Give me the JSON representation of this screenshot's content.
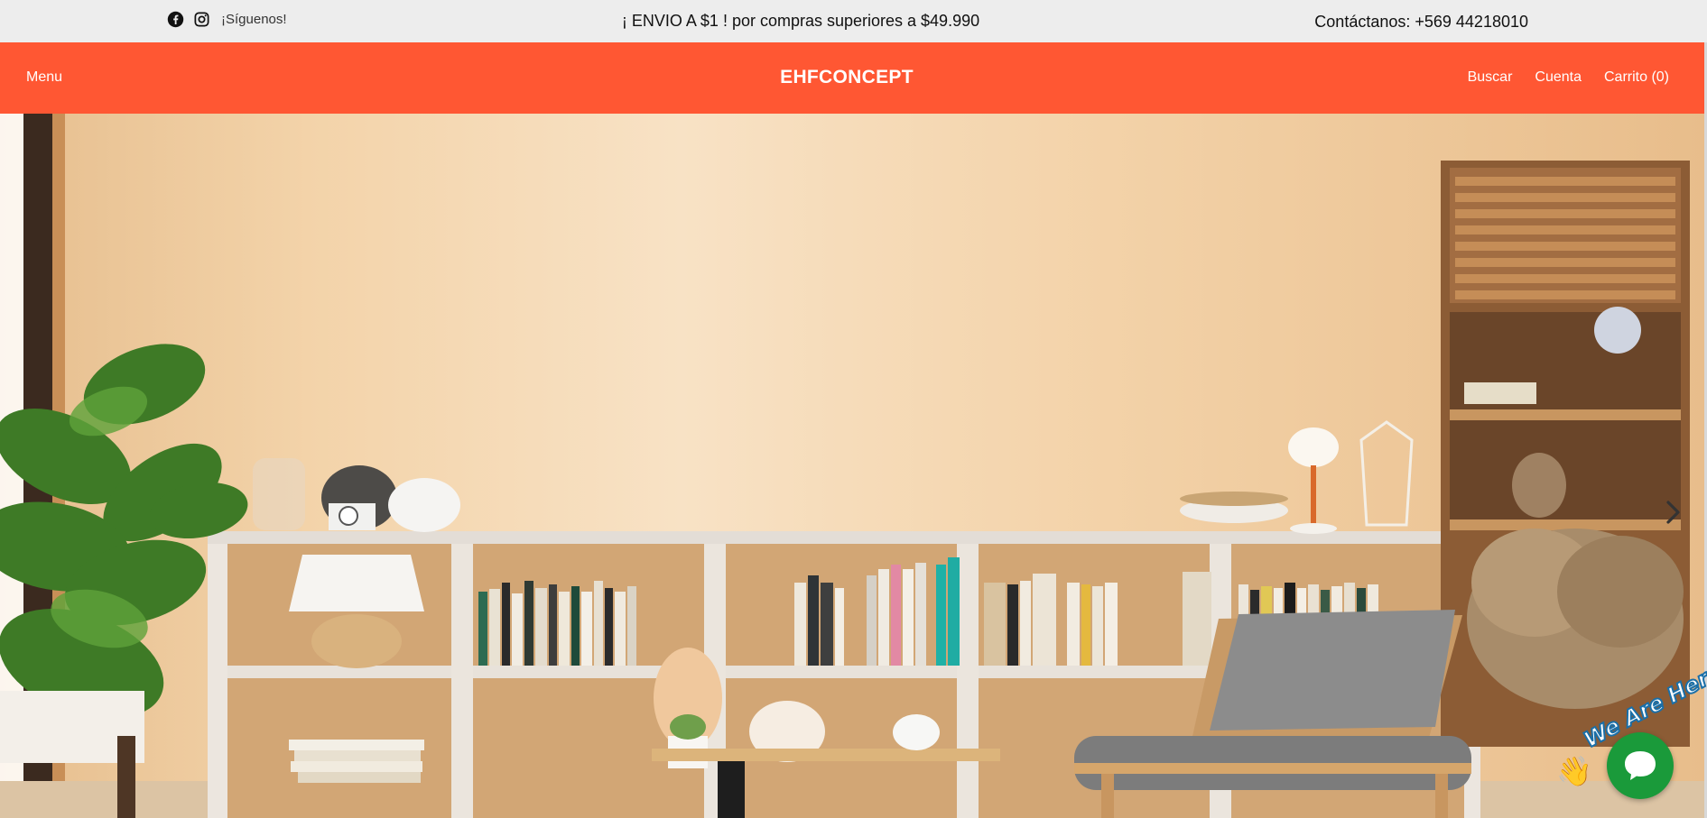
{
  "topbar": {
    "social_icons": [
      "facebook-icon",
      "instagram-icon"
    ],
    "follow_text": "¡Síguenos!",
    "promo_text": "¡ ENVIO A $1 ! por compras superiores a $49.990",
    "contact_text": "Contáctanos: +569 44218010"
  },
  "header": {
    "menu_label": "Menu",
    "brand": "EHFCONCEPT",
    "nav": {
      "search": "Buscar",
      "account": "Cuenta",
      "cart": "Carrito (0)"
    }
  },
  "hero": {
    "next_icon": "chevron-right-icon"
  },
  "chat": {
    "badge_text": "We Are Here!",
    "hand_icon": "waving-hand-icon",
    "bubble_icon": "chat-bubble-icon"
  },
  "colors": {
    "brand": "#ff5733",
    "topbar_bg": "#ededed",
    "chat_green": "#1a9a3a"
  }
}
